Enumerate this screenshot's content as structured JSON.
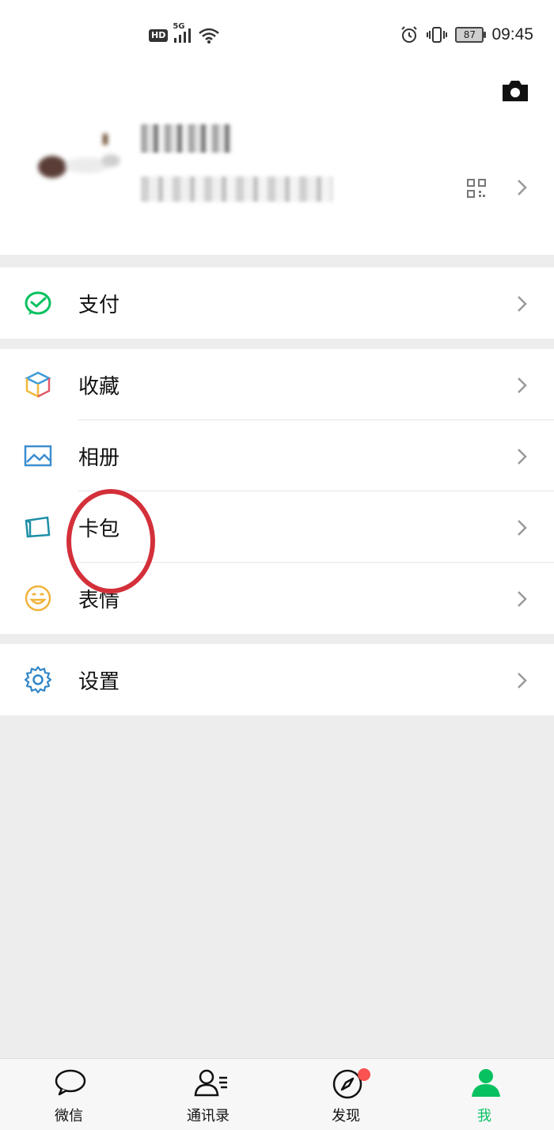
{
  "status_bar": {
    "network_badge": "HD",
    "network_type": "5G",
    "battery_level": "87",
    "time": "09:45"
  },
  "menu": {
    "pay": "支付",
    "favorites": "收藏",
    "album": "相册",
    "card_wallet": "卡包",
    "stickers": "表情",
    "settings": "设置"
  },
  "tab_bar": {
    "tabs": [
      {
        "label": "微信",
        "icon": "chat-bubble-icon"
      },
      {
        "label": "通讯录",
        "icon": "contacts-icon"
      },
      {
        "label": "发现",
        "icon": "compass-icon"
      },
      {
        "label": "我",
        "icon": "person-icon"
      }
    ],
    "active_tab": "我"
  },
  "colors": {
    "accent_green": "#07c160",
    "annotation_red": "#d3303a",
    "badge_red": "#fa5151",
    "background_gray": "#ededed"
  }
}
